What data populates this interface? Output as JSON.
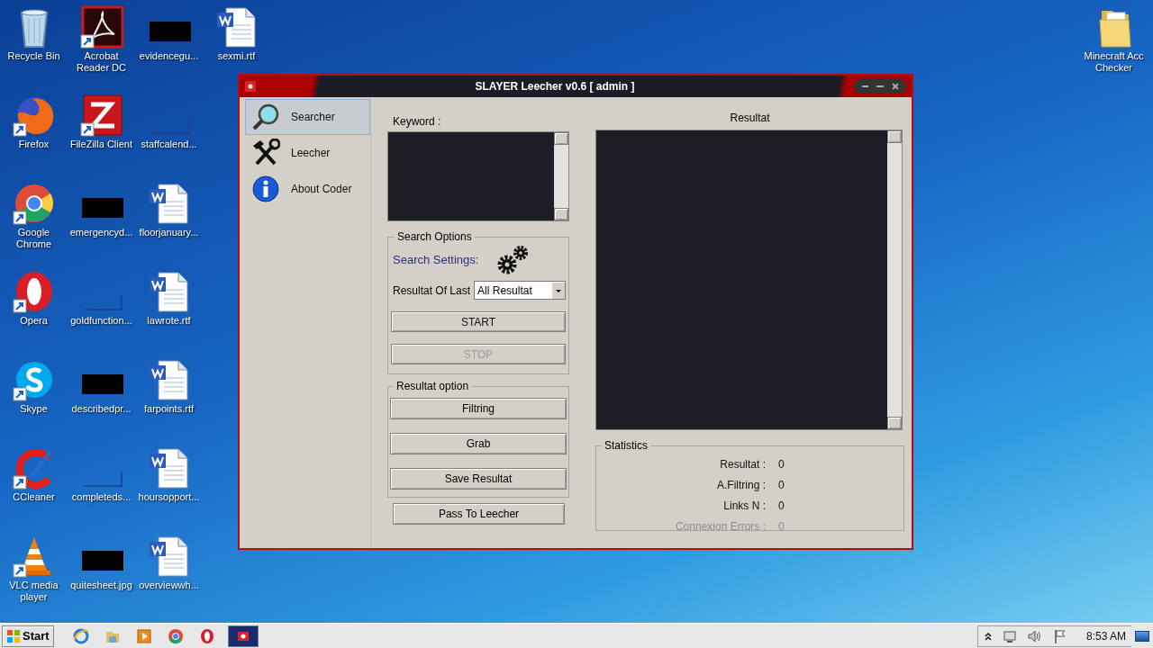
{
  "desktop_icons": [
    {
      "label": "Recycle Bin",
      "kind": "recycle",
      "shortcut": false
    },
    {
      "label": "Firefox",
      "kind": "firefox",
      "shortcut": true
    },
    {
      "label": "Google Chrome",
      "kind": "chrome",
      "shortcut": true
    },
    {
      "label": "Opera",
      "kind": "opera",
      "shortcut": true
    },
    {
      "label": "Skype",
      "kind": "skype",
      "shortcut": true
    },
    {
      "label": "CCleaner",
      "kind": "ccleaner",
      "shortcut": true
    },
    {
      "label": "VLC media player",
      "kind": "vlc",
      "shortcut": true
    },
    {
      "label": "Acrobat Reader DC",
      "kind": "acrobat",
      "shortcut": true
    },
    {
      "label": "FileZilla Client",
      "kind": "filezilla",
      "shortcut": true
    },
    {
      "label": "emergencyd...",
      "kind": "redacted",
      "shortcut": false
    },
    {
      "label": "goldfunction...",
      "kind": "blank",
      "shortcut": false
    },
    {
      "label": "describedpr...",
      "kind": "redacted",
      "shortcut": false
    },
    {
      "label": "completeds...",
      "kind": "blank",
      "shortcut": false
    },
    {
      "label": "quitesheet.jpg",
      "kind": "redacted",
      "shortcut": false
    },
    {
      "label": "evidencegu...",
      "kind": "redacted",
      "shortcut": false
    },
    {
      "label": "staffcalend...",
      "kind": "blank",
      "shortcut": false
    },
    {
      "label": "floorjanuary...",
      "kind": "word",
      "shortcut": false
    },
    {
      "label": "lawrote.rtf",
      "kind": "word",
      "shortcut": false
    },
    {
      "label": "farpoints.rtf",
      "kind": "word",
      "shortcut": false
    },
    {
      "label": "hoursopport...",
      "kind": "word",
      "shortcut": false
    },
    {
      "label": "overviewwh...",
      "kind": "word",
      "shortcut": false
    },
    {
      "label": "sexmi.rtf",
      "kind": "word",
      "shortcut": false
    }
  ],
  "desktop_icons_right": [
    {
      "label": "Minecraft Acc Checker",
      "kind": "folder",
      "shortcut": false
    }
  ],
  "window": {
    "title": "SLAYER Leecher v0.6 [ admin ]",
    "nav": [
      {
        "label": "Searcher",
        "kind": "search",
        "selected": true
      },
      {
        "label": "Leecher",
        "kind": "tools",
        "selected": false
      },
      {
        "label": "About Coder",
        "kind": "info",
        "selected": false
      }
    ],
    "keyword": {
      "label": "Keyword :"
    },
    "search_options": {
      "title": "Search Options",
      "settings_label": "Search Settings:",
      "last_label": "Resultat Of Last",
      "last_value": "All Resultat",
      "buttons": [
        {
          "label": "START",
          "disabled": false
        },
        {
          "label": "STOP",
          "disabled": true
        }
      ]
    },
    "resultat_option": {
      "title": "Resultat option",
      "buttons": [
        "Filtring",
        "Grab",
        "Save Resultat"
      ]
    },
    "pass_button": "Pass To Leecher",
    "results": {
      "label": "Resultat"
    },
    "statistics": {
      "title": "Statistics",
      "rows": [
        {
          "label": "Resultat :",
          "value": "0",
          "disabled": false
        },
        {
          "label": "A.Filtring :",
          "value": "0",
          "disabled": false
        },
        {
          "label": "Links N :",
          "value": "0",
          "disabled": false
        },
        {
          "label": "Connexion Errors :",
          "value": "0",
          "disabled": true
        }
      ]
    }
  },
  "taskbar": {
    "start": "Start",
    "apps": [
      {
        "kind": "ie",
        "selected": false
      },
      {
        "kind": "explorer",
        "selected": false
      },
      {
        "kind": "media",
        "selected": false
      },
      {
        "kind": "chrome",
        "selected": false
      },
      {
        "kind": "opera",
        "selected": false
      },
      {
        "kind": "slayer",
        "selected": true
      }
    ],
    "clock": "8:53 AM"
  }
}
